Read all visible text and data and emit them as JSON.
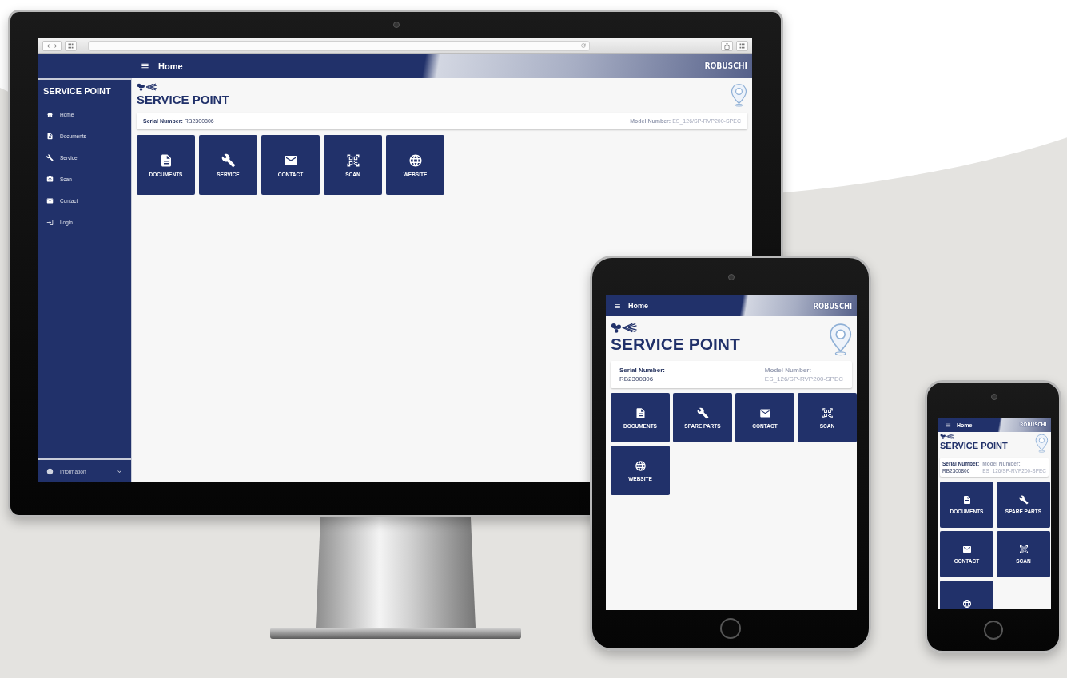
{
  "devices": [
    {
      "kind": "desktop",
      "header": {
        "title": "Home",
        "logo": "ROBUSCHI"
      },
      "sidebar": {
        "title": "SERVICE POINT",
        "items": [
          {
            "label": "Home",
            "kind": "home"
          },
          {
            "label": "Documents",
            "kind": "documents"
          },
          {
            "label": "Service",
            "kind": "service"
          },
          {
            "label": "Scan",
            "kind": "scan"
          },
          {
            "label": "Contact",
            "kind": "contact"
          },
          {
            "label": "Login",
            "kind": "login"
          }
        ],
        "footer": {
          "label": "Information"
        }
      },
      "page": {
        "title": "SERVICE POINT",
        "serial_label": "Serial Number:",
        "serial_value": "RB2300806",
        "model_label": "Model Number:",
        "model_value": "ES_126/SP-RVP200-SPEC"
      },
      "tiles": [
        {
          "label": "DOCUMENTS",
          "kind": "documents"
        },
        {
          "label": "SERVICE",
          "kind": "service"
        },
        {
          "label": "CONTACT",
          "kind": "contact"
        },
        {
          "label": "SCAN",
          "kind": "scan"
        },
        {
          "label": "WEBSITE",
          "kind": "website"
        }
      ]
    },
    {
      "kind": "tablet",
      "header": {
        "title": "Home",
        "logo": "ROBUSCHI"
      },
      "page": {
        "title": "SERVICE POINT",
        "serial_label": "Serial Number:",
        "serial_value": "RB2300806",
        "model_label": "Model Number:",
        "model_value": "ES_126/SP-RVP200-SPEC"
      },
      "tiles": [
        {
          "label": "DOCUMENTS",
          "kind": "documents"
        },
        {
          "label": "SPARE PARTS",
          "kind": "service"
        },
        {
          "label": "CONTACT",
          "kind": "contact"
        },
        {
          "label": "SCAN",
          "kind": "scan"
        },
        {
          "label": "WEBSITE",
          "kind": "website"
        }
      ]
    },
    {
      "kind": "phone",
      "header": {
        "title": "Home",
        "logo": "ROBUSCHI"
      },
      "page": {
        "title": "SERVICE POINT",
        "serial_label": "Serial Number:",
        "serial_value": "RB2300806",
        "model_label": "Model Number:",
        "model_value": "ES_126/SP-RVP200-SPEC"
      },
      "tiles": [
        {
          "label": "DOCUMENTS",
          "kind": "documents"
        },
        {
          "label": "SPARE PARTS",
          "kind": "service"
        },
        {
          "label": "CONTACT",
          "kind": "contact"
        },
        {
          "label": "SCAN",
          "kind": "scan"
        },
        {
          "kind": "website"
        }
      ]
    }
  ]
}
